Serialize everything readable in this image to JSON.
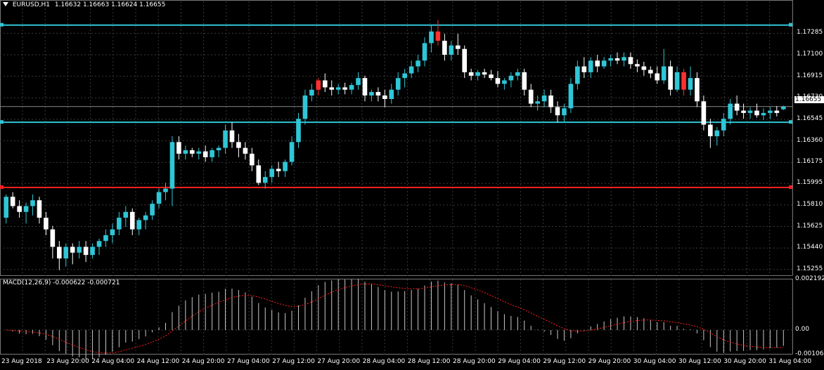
{
  "header": {
    "symbol": "EURUSD,H1",
    "ohlc": "1.16632 1.16663 1.16624 1.16655"
  },
  "price_axis": {
    "ticks": [
      "1.17285",
      "1.17100",
      "1.16915",
      "1.16730",
      "1.16545",
      "1.16360",
      "1.16175",
      "1.15995",
      "1.15810",
      "1.15625",
      "1.15440",
      "1.15255"
    ],
    "current_price": "1.16655"
  },
  "macd": {
    "label": "MACD(12,26,9) -0.000622 -0.000721",
    "ticks": [
      "0.002192",
      "0.00",
      "-0.001063"
    ]
  },
  "time_axis": {
    "labels": [
      "23 Aug 2018",
      "23 Aug 20:00",
      "24 Aug 04:00",
      "24 Aug 12:00",
      "24 Aug 20:00",
      "27 Aug 04:00",
      "27 Aug 12:00",
      "27 Aug 20:00",
      "28 Aug 04:00",
      "28 Aug 12:00",
      "28 Aug 20:00",
      "29 Aug 04:00",
      "29 Aug 12:00",
      "29 Aug 20:00",
      "30 Aug 04:00",
      "30 Aug 12:00",
      "30 Aug 20:00",
      "31 Aug 04:00"
    ]
  },
  "levels": [
    {
      "price": 1.17355,
      "color": "#2fc6d6",
      "name": "resistance-line"
    },
    {
      "price": 1.1652,
      "color": "#2fc6d6",
      "name": "support-line"
    },
    {
      "price": 1.1596,
      "color": "#ff2020",
      "name": "red-level-line"
    }
  ],
  "colors": {
    "bull": "#2fc6d6",
    "bear": "#ffffff",
    "grid": "#3a3a3a",
    "macd_signal": "#ff2020"
  },
  "chart_data": {
    "type": "candlestick",
    "symbol": "EURUSD",
    "timeframe": "H1",
    "ylim": [
      1.152,
      1.1748
    ],
    "candles": [
      [
        1.157,
        1.159,
        1.1565,
        1.1588
      ],
      [
        1.1588,
        1.1592,
        1.1578,
        1.158
      ],
      [
        1.158,
        1.1585,
        1.157,
        1.1575
      ],
      [
        1.1575,
        1.1583,
        1.1565,
        1.158
      ],
      [
        1.158,
        1.159,
        1.1572,
        1.1585
      ],
      [
        1.1585,
        1.1588,
        1.1565,
        1.157
      ],
      [
        1.157,
        1.1575,
        1.1555,
        1.156
      ],
      [
        1.156,
        1.1563,
        1.1535,
        1.1545
      ],
      [
        1.1545,
        1.155,
        1.1525,
        1.1535
      ],
      [
        1.1535,
        1.1548,
        1.1528,
        1.1545
      ],
      [
        1.1545,
        1.1548,
        1.153,
        1.154
      ],
      [
        1.154,
        1.155,
        1.1535,
        1.1545
      ],
      [
        1.1545,
        1.155,
        1.1532,
        1.1538
      ],
      [
        1.1538,
        1.1548,
        1.1535,
        1.1545
      ],
      [
        1.1545,
        1.1552,
        1.1538,
        1.155
      ],
      [
        1.155,
        1.156,
        1.1545,
        1.1555
      ],
      [
        1.1555,
        1.1565,
        1.1548,
        1.156
      ],
      [
        1.156,
        1.1575,
        1.1555,
        1.157
      ],
      [
        1.157,
        1.158,
        1.1562,
        1.1575
      ],
      [
        1.1575,
        1.1578,
        1.1555,
        1.156
      ],
      [
        1.156,
        1.157,
        1.1555,
        1.1568
      ],
      [
        1.1568,
        1.1575,
        1.156,
        1.1572
      ],
      [
        1.1572,
        1.1585,
        1.1568,
        1.1582
      ],
      [
        1.1582,
        1.1595,
        1.1578,
        1.1592
      ],
      [
        1.1592,
        1.16,
        1.1585,
        1.1595
      ],
      [
        1.1595,
        1.164,
        1.158,
        1.1635
      ],
      [
        1.1635,
        1.164,
        1.162,
        1.1625
      ],
      [
        1.1625,
        1.1632,
        1.162,
        1.1628
      ],
      [
        1.1628,
        1.163,
        1.1622,
        1.1625
      ],
      [
        1.1625,
        1.163,
        1.162,
        1.1627
      ],
      [
        1.1627,
        1.1632,
        1.1618,
        1.1622
      ],
      [
        1.1622,
        1.163,
        1.1618,
        1.1628
      ],
      [
        1.1628,
        1.1632,
        1.1622,
        1.163
      ],
      [
        1.163,
        1.165,
        1.1625,
        1.1645
      ],
      [
        1.1645,
        1.1652,
        1.163,
        1.1635
      ],
      [
        1.1635,
        1.1642,
        1.1622,
        1.163
      ],
      [
        1.163,
        1.1635,
        1.162,
        1.1625
      ],
      [
        1.1625,
        1.163,
        1.161,
        1.1615
      ],
      [
        1.1615,
        1.162,
        1.1598,
        1.16
      ],
      [
        1.16,
        1.161,
        1.1595,
        1.1605
      ],
      [
        1.1605,
        1.1615,
        1.16,
        1.1612
      ],
      [
        1.1612,
        1.1618,
        1.1605,
        1.161
      ],
      [
        1.161,
        1.162,
        1.1605,
        1.1618
      ],
      [
        1.1618,
        1.164,
        1.1615,
        1.1635
      ],
      [
        1.1635,
        1.166,
        1.163,
        1.1655
      ],
      [
        1.1655,
        1.168,
        1.165,
        1.1675
      ],
      [
        1.1675,
        1.1685,
        1.167,
        1.168
      ],
      [
        1.168,
        1.169,
        1.1675,
        1.1688
      ],
      [
        1.1688,
        1.1694,
        1.1678,
        1.1682
      ],
      [
        1.1682,
        1.1688,
        1.1675,
        1.168
      ],
      [
        1.168,
        1.1685,
        1.1676,
        1.1682
      ],
      [
        1.1682,
        1.1686,
        1.1676,
        1.168
      ],
      [
        1.168,
        1.1686,
        1.1676,
        1.1684
      ],
      [
        1.1684,
        1.1695,
        1.168,
        1.169
      ],
      [
        1.169,
        1.1692,
        1.167,
        1.1675
      ],
      [
        1.1675,
        1.168,
        1.167,
        1.1678
      ],
      [
        1.1678,
        1.1682,
        1.167,
        1.1675
      ],
      [
        1.1675,
        1.168,
        1.1665,
        1.1672
      ],
      [
        1.1672,
        1.1685,
        1.1668,
        1.168
      ],
      [
        1.168,
        1.1695,
        1.1675,
        1.169
      ],
      [
        1.169,
        1.1698,
        1.1682,
        1.1694
      ],
      [
        1.1694,
        1.1705,
        1.169,
        1.17
      ],
      [
        1.17,
        1.171,
        1.1695,
        1.1705
      ],
      [
        1.1705,
        1.1725,
        1.17,
        1.172
      ],
      [
        1.172,
        1.1735,
        1.1712,
        1.173
      ],
      [
        1.173,
        1.174,
        1.1718,
        1.1722
      ],
      [
        1.1722,
        1.1728,
        1.1705,
        1.171
      ],
      [
        1.171,
        1.1722,
        1.1705,
        1.1718
      ],
      [
        1.1718,
        1.1728,
        1.171,
        1.1715
      ],
      [
        1.1715,
        1.1718,
        1.169,
        1.1695
      ],
      [
        1.1695,
        1.1698,
        1.1688,
        1.1692
      ],
      [
        1.1692,
        1.1697,
        1.1688,
        1.1695
      ],
      [
        1.1695,
        1.1698,
        1.169,
        1.1693
      ],
      [
        1.1693,
        1.1697,
        1.1688,
        1.169
      ],
      [
        1.169,
        1.1696,
        1.1682,
        1.1685
      ],
      [
        1.1685,
        1.169,
        1.168,
        1.1688
      ],
      [
        1.1688,
        1.1695,
        1.1682,
        1.1692
      ],
      [
        1.1692,
        1.1698,
        1.1688,
        1.1695
      ],
      [
        1.1695,
        1.1698,
        1.1675,
        1.168
      ],
      [
        1.168,
        1.1685,
        1.1665,
        1.1668
      ],
      [
        1.1668,
        1.1675,
        1.1662,
        1.167
      ],
      [
        1.167,
        1.168,
        1.1665,
        1.1675
      ],
      [
        1.1675,
        1.168,
        1.166,
        1.1665
      ],
      [
        1.1665,
        1.167,
        1.1652,
        1.1658
      ],
      [
        1.1658,
        1.1668,
        1.1652,
        1.1664
      ],
      [
        1.1664,
        1.169,
        1.166,
        1.1685
      ],
      [
        1.1685,
        1.1705,
        1.168,
        1.17
      ],
      [
        1.17,
        1.1708,
        1.169,
        1.1695
      ],
      [
        1.1695,
        1.1708,
        1.169,
        1.1705
      ],
      [
        1.1705,
        1.171,
        1.1695,
        1.17
      ],
      [
        1.17,
        1.1708,
        1.1698,
        1.1705
      ],
      [
        1.1705,
        1.171,
        1.17,
        1.1707
      ],
      [
        1.1707,
        1.1712,
        1.1702,
        1.1705
      ],
      [
        1.1705,
        1.1712,
        1.17,
        1.1708
      ],
      [
        1.1708,
        1.1712,
        1.1698,
        1.1702
      ],
      [
        1.1702,
        1.1706,
        1.1695,
        1.17
      ],
      [
        1.17,
        1.1704,
        1.1692,
        1.1697
      ],
      [
        1.1697,
        1.17,
        1.169,
        1.1694
      ],
      [
        1.1694,
        1.17,
        1.1685,
        1.1688
      ],
      [
        1.1688,
        1.1715,
        1.1685,
        1.17
      ],
      [
        1.17,
        1.1705,
        1.1675,
        1.168
      ],
      [
        1.168,
        1.17,
        1.1678,
        1.1695
      ],
      [
        1.1695,
        1.1698,
        1.1675,
        1.168
      ],
      [
        1.168,
        1.17,
        1.1675,
        1.169
      ],
      [
        1.169,
        1.1695,
        1.1665,
        1.167
      ],
      [
        1.167,
        1.1675,
        1.1645,
        1.165
      ],
      [
        1.165,
        1.1655,
        1.163,
        1.164
      ],
      [
        1.164,
        1.1648,
        1.1632,
        1.1645
      ],
      [
        1.1645,
        1.166,
        1.164,
        1.1655
      ],
      [
        1.1655,
        1.1672,
        1.165,
        1.1668
      ],
      [
        1.1668,
        1.1675,
        1.1658,
        1.1662
      ],
      [
        1.1662,
        1.1668,
        1.1655,
        1.166
      ],
      [
        1.166,
        1.1665,
        1.1655,
        1.1662
      ],
      [
        1.1662,
        1.1668,
        1.1656,
        1.1658
      ],
      [
        1.1658,
        1.1664,
        1.1654,
        1.166
      ],
      [
        1.166,
        1.1665,
        1.1655,
        1.1662
      ],
      [
        1.1662,
        1.1666,
        1.1657,
        1.166
      ],
      [
        1.16632,
        1.16663,
        1.16624,
        1.16655
      ]
    ],
    "bear_highlight_indices": [
      47,
      65,
      102
    ],
    "macd": {
      "label": "MACD(12,26,9)",
      "macd_value": -0.000622,
      "signal_value": -0.000721,
      "ylim": [
        -0.001063,
        0.002192
      ]
    }
  }
}
